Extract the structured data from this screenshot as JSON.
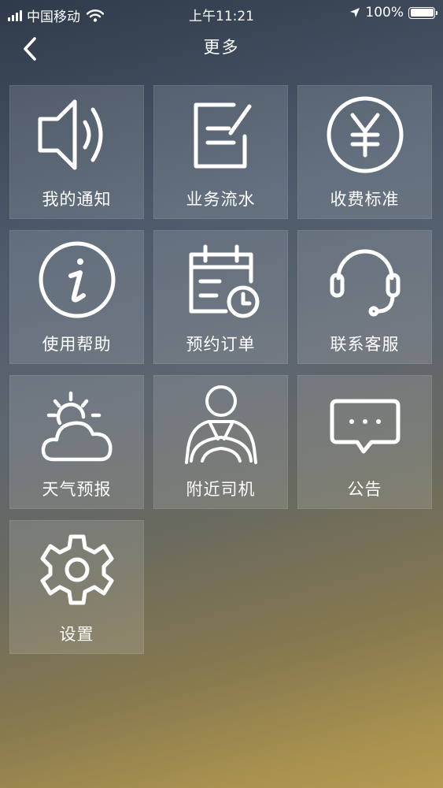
{
  "status_bar": {
    "carrier": "中国移动",
    "time": "上午11:21",
    "battery": "100%"
  },
  "nav": {
    "title": "更多"
  },
  "menu": [
    {
      "label": "我的通知",
      "icon": "speaker-icon"
    },
    {
      "label": "业务流水",
      "icon": "edit-note-icon"
    },
    {
      "label": "收费标准",
      "icon": "yen-icon"
    },
    {
      "label": "使用帮助",
      "icon": "info-icon"
    },
    {
      "label": "预约订单",
      "icon": "calendar-clock-icon"
    },
    {
      "label": "联系客服",
      "icon": "headset-icon"
    },
    {
      "label": "天气预报",
      "icon": "weather-icon"
    },
    {
      "label": "附近司机",
      "icon": "driver-icon"
    },
    {
      "label": "公告",
      "icon": "chat-bubble-icon"
    },
    {
      "label": "设置",
      "icon": "gear-icon"
    }
  ]
}
